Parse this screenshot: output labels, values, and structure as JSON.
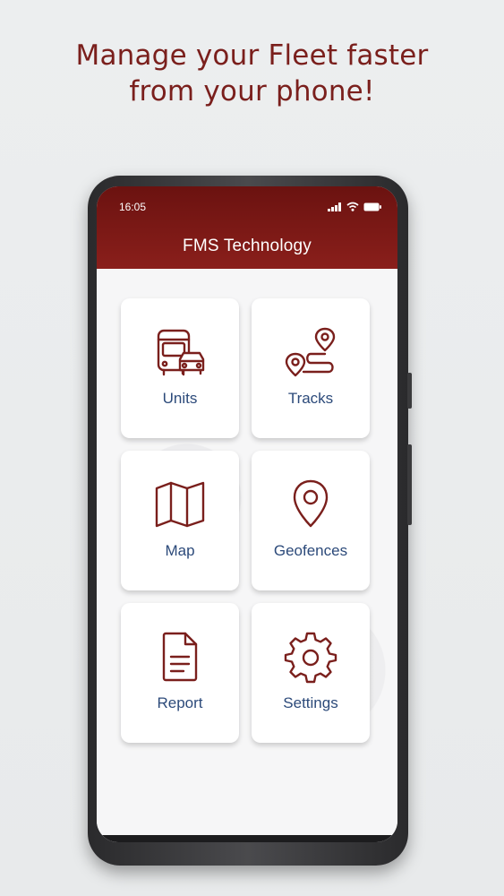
{
  "headline": {
    "line1": "Manage your Fleet faster",
    "line2": "from your phone!"
  },
  "status_bar": {
    "time": "16:05",
    "icons": [
      "signal-icon",
      "wifi-icon",
      "battery-icon"
    ]
  },
  "app": {
    "title": "FMS Technology"
  },
  "menu": [
    {
      "label": "Units",
      "icon": "bus-car-icon"
    },
    {
      "label": "Tracks",
      "icon": "route-icon"
    },
    {
      "label": "Map",
      "icon": "map-icon"
    },
    {
      "label": "Geofences",
      "icon": "location-pin-icon"
    },
    {
      "label": "Report",
      "icon": "document-icon"
    },
    {
      "label": "Settings",
      "icon": "gear-icon"
    }
  ],
  "colors": {
    "brand": "#8a1f1b",
    "label": "#2c4a7a"
  }
}
